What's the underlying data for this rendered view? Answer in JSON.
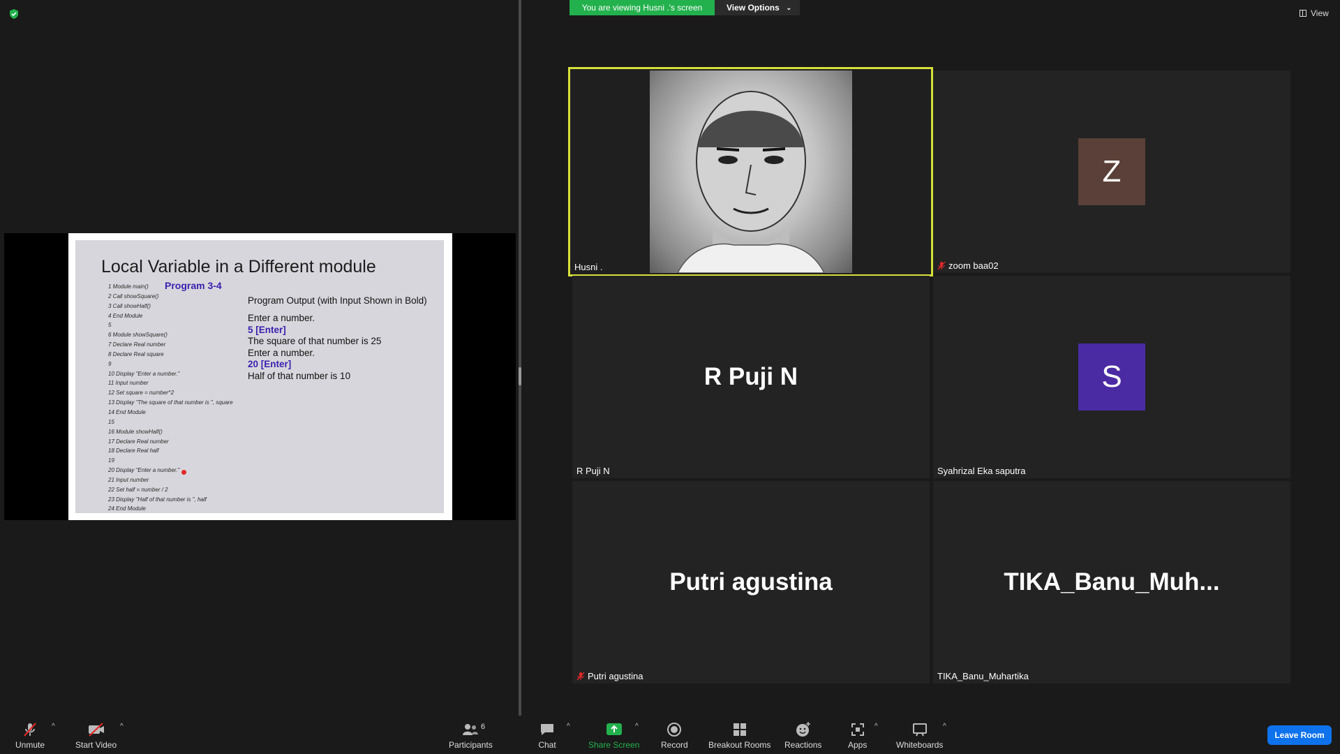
{
  "banner": {
    "viewing_text": "You are viewing Husni .'s screen",
    "view_options_label": "View Options",
    "view_label": "View"
  },
  "slide": {
    "title": "Local Variable in a Different module",
    "program_label": "Program 3-4",
    "code_lines": [
      "1 Module main()",
      "2    Call showSquare()",
      "3    Call showHalf()",
      "4 End Module",
      "5",
      "6 Module showSquare()",
      "7    Declare Real number",
      "8    Declare Real square",
      "9",
      "10   Display \"Enter a number.\"",
      "11   Input number",
      "12   Set square = number^2",
      "13   Display \"The square of that number is \", square",
      "14 End Module",
      "15",
      "16 Module showHalf()",
      "17   Declare Real number",
      "18   Declare Real half",
      "19",
      "20   Display \"Enter a number.\"",
      "21   Input number",
      "22   Set half = number / 2",
      "23   Display \"Half of that number is \", half",
      "24 End Module"
    ],
    "output_header": "Program Output (with Input Shown in Bold)",
    "output_lines": [
      {
        "text": "Enter a number.",
        "bold": false
      },
      {
        "text": "5 [Enter]",
        "bold": true
      },
      {
        "text": "The square of that number is 25",
        "bold": false
      },
      {
        "text": "Enter a number.",
        "bold": false
      },
      {
        "text": "20 [Enter]",
        "bold": true
      },
      {
        "text": "Half of that number is 10",
        "bold": false
      }
    ]
  },
  "participants_grid": [
    {
      "id": "husni",
      "name_tag": "Husni .",
      "muted": false,
      "active_speaker": true
    },
    {
      "id": "zoom",
      "name_tag": "zoom baa02",
      "muted": true,
      "avatar_letter": "Z",
      "avatar_color": "#5a4038"
    },
    {
      "id": "rpuji",
      "name_tag": "R Puji N",
      "display_name": "R Puji N",
      "muted": false
    },
    {
      "id": "syahrizal",
      "name_tag": "Syahrizal Eka saputra",
      "muted": false,
      "avatar_letter": "S",
      "avatar_color": "#4b2ba3"
    },
    {
      "id": "putri",
      "name_tag": "Putri agustina",
      "display_name": "Putri agustina",
      "muted": true
    },
    {
      "id": "tika",
      "name_tag": "TIKA_Banu_Muhartika",
      "display_name": "TIKA_Banu_Muh...",
      "muted": false
    }
  ],
  "toolbar": {
    "unmute": "Unmute",
    "start_video": "Start Video",
    "participants": "Participants",
    "participants_count": "6",
    "chat": "Chat",
    "share_screen": "Share Screen",
    "record": "Record",
    "breakout_rooms": "Breakout Rooms",
    "reactions": "Reactions",
    "apps": "Apps",
    "whiteboards": "Whiteboards",
    "leave_room": "Leave Room"
  },
  "colors": {
    "share_green": "#23b14d",
    "active_speaker_border": "#d6e03a",
    "leave_blue": "#0e72ed",
    "mute_red": "#e02828",
    "slide_accent": "#3b1fae"
  }
}
